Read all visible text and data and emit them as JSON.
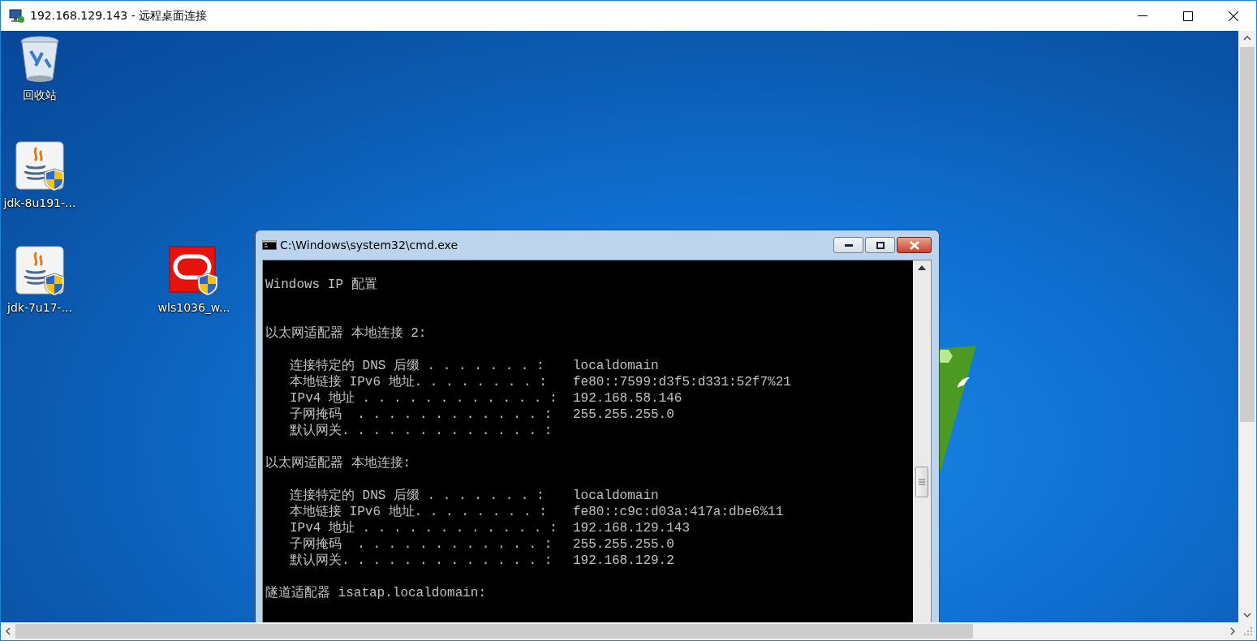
{
  "window": {
    "title": "192.168.129.143 - 远程桌面连接"
  },
  "desktop_icons": [
    {
      "kind": "recycle-bin",
      "label": "回收站"
    },
    {
      "kind": "java-installer",
      "label": "jdk-8u191-..."
    },
    {
      "kind": "java-installer",
      "label": "jdk-7u17-..."
    },
    {
      "kind": "oracle-installer",
      "label": "wls1036_w..."
    }
  ],
  "console_window": {
    "title": "C:\\Windows\\system32\\cmd.exe",
    "sections": [
      {
        "heading": "Windows IP 配置"
      },
      {
        "heading": "以太网适配器 本地连接 2:",
        "entries": [
          {
            "label": "连接特定的 DNS 后缀 . . . . . . . :",
            "value": "localdomain"
          },
          {
            "label": "本地链接 IPv6 地址. . . . . . . . :",
            "value": "fe80::7599:d3f5:d331:52f7%21"
          },
          {
            "label": "IPv4 地址 . . . . . . . . . . . . :",
            "value": "192.168.58.146"
          },
          {
            "label": "子网掩码  . . . . . . . . . . . . :",
            "value": "255.255.255.0"
          },
          {
            "label": "默认网关. . . . . . . . . . . . . :"
          }
        ]
      },
      {
        "heading": "以太网适配器 本地连接:",
        "entries": [
          {
            "label": "连接特定的 DNS 后缀 . . . . . . . :",
            "value": "localdomain"
          },
          {
            "label": "本地链接 IPv6 地址. . . . . . . . :",
            "value": "fe80::c9c:d03a:417a:dbe6%11"
          },
          {
            "label": "IPv4 地址 . . . . . . . . . . . . :",
            "value": "192.168.129.143"
          },
          {
            "label": "子网掩码  . . . . . . . . . . . . :",
            "value": "255.255.255.0"
          },
          {
            "label": "默认网关. . . . . . . . . . . . . :",
            "value": "192.168.129.2"
          }
        ]
      },
      {
        "heading": "隧道适配器 isatap.localdomain:"
      }
    ]
  }
}
